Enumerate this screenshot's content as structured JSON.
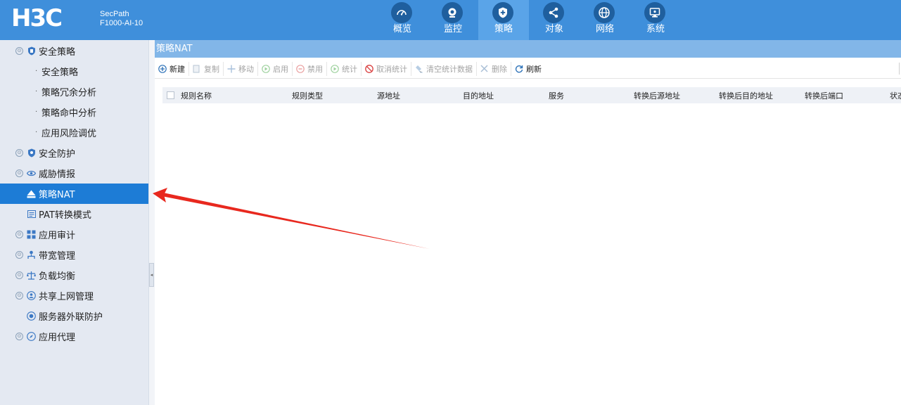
{
  "header": {
    "logo": "H3C",
    "product_line1": "SecPath",
    "product_line2": "F1000-AI-10",
    "nav": [
      {
        "label": "概览",
        "icon": "gauge-icon"
      },
      {
        "label": "监控",
        "icon": "monitor-camera-icon"
      },
      {
        "label": "策略",
        "icon": "shield-plus-icon",
        "active": true
      },
      {
        "label": "对象",
        "icon": "share-nodes-icon"
      },
      {
        "label": "网络",
        "icon": "globe-icon"
      },
      {
        "label": "系统",
        "icon": "computer-screen-icon"
      }
    ]
  },
  "sidebar": {
    "items": [
      {
        "label": "安全策略",
        "level": 1,
        "icon": "shield-icon",
        "expanded": true
      },
      {
        "label": "安全策略",
        "level": 2
      },
      {
        "label": "策略冗余分析",
        "level": 2
      },
      {
        "label": "策略命中分析",
        "level": 2
      },
      {
        "label": "应用风险调优",
        "level": 2
      },
      {
        "label": "安全防护",
        "level": 1,
        "icon": "shield-icon"
      },
      {
        "label": "威胁情报",
        "level": 1,
        "icon": "eye-icon"
      },
      {
        "label": "策略NAT",
        "level": 1,
        "icon": "nat-icon",
        "active": true
      },
      {
        "label": "PAT转换模式",
        "level": 1,
        "icon": "pat-icon"
      },
      {
        "label": "应用审计",
        "level": 1,
        "icon": "app-grid-icon"
      },
      {
        "label": "带宽管理",
        "level": 1,
        "icon": "org-tree-icon"
      },
      {
        "label": "负载均衡",
        "level": 1,
        "icon": "balance-icon"
      },
      {
        "label": "共享上网管理",
        "level": 1,
        "icon": "shared-users-icon"
      },
      {
        "label": "服务器外联防护",
        "level": 1,
        "icon": "server-protect-icon"
      },
      {
        "label": "应用代理",
        "level": 1,
        "icon": "compass-icon"
      }
    ]
  },
  "main": {
    "title": "策略NAT",
    "toolbar": [
      {
        "label": "新建",
        "icon": "add-circle-icon",
        "enabled": true
      },
      {
        "label": "复制",
        "icon": "copy-icon",
        "enabled": false
      },
      {
        "label": "移动",
        "icon": "move-icon",
        "enabled": false
      },
      {
        "label": "启用",
        "icon": "play-circle-icon",
        "enabled": false
      },
      {
        "label": "禁用",
        "icon": "minus-circle-icon",
        "enabled": false
      },
      {
        "label": "统计",
        "icon": "play-circle-icon",
        "enabled": false
      },
      {
        "label": "取消统计",
        "icon": "prohibit-icon",
        "enabled": false
      },
      {
        "label": "清空统计数据",
        "icon": "eraser-icon",
        "enabled": false
      },
      {
        "label": "删除",
        "icon": "close-icon",
        "enabled": false
      },
      {
        "label": "刷新",
        "icon": "refresh-icon",
        "enabled": true
      }
    ],
    "columns": [
      "规则名称",
      "规则类型",
      "源地址",
      "目的地址",
      "服务",
      "转换后源地址",
      "转换后目的地址",
      "转换后端口",
      "状态"
    ]
  },
  "annotation": {
    "color": "#e8281e"
  }
}
